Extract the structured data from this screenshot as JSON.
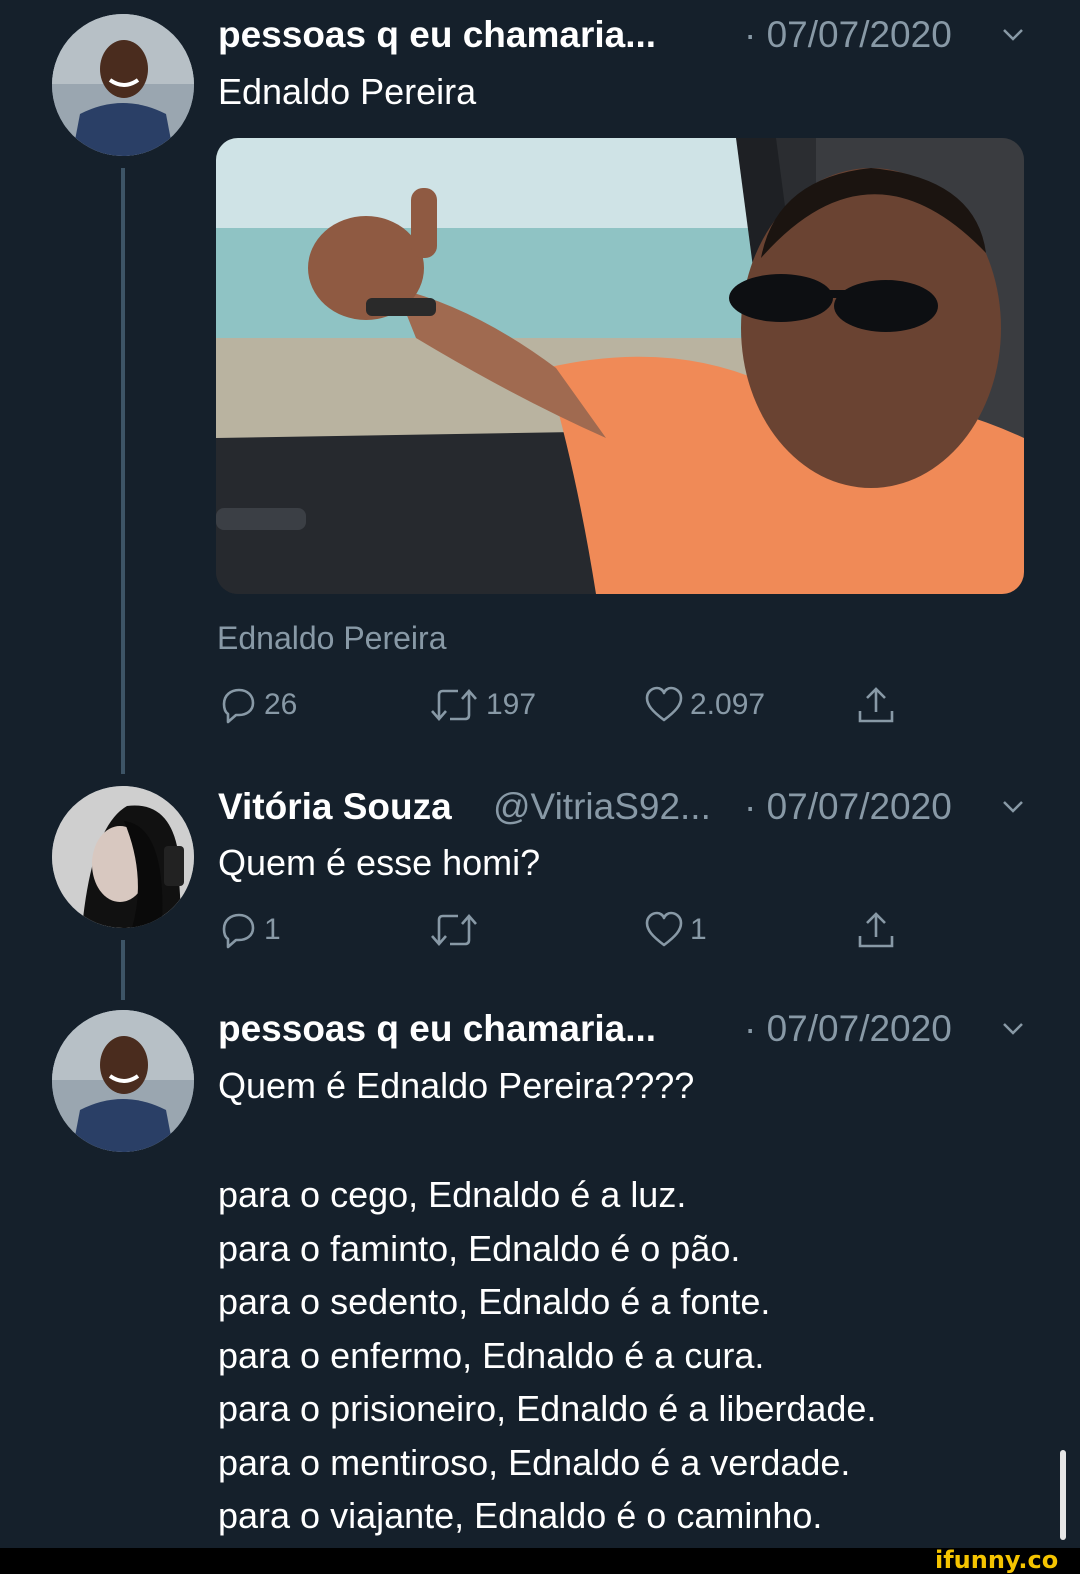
{
  "tweets": [
    {
      "author": "pessoas q eu chamaria...",
      "date": "· 07/07/2020",
      "text": "Ednaldo Pereira",
      "caption": "Ednaldo Pereira",
      "stats": {
        "replies": "26",
        "retweets": "197",
        "likes": "2.097"
      }
    },
    {
      "author": "Vitória Souza",
      "handle": "@VitriaS92...",
      "date": "· 07/07/2020",
      "text": "Quem é esse homi?",
      "stats": {
        "replies": "1",
        "retweets": "",
        "likes": "1"
      }
    },
    {
      "author": "pessoas q eu chamaria...",
      "date": "· 07/07/2020",
      "text": "Quem é Ednaldo Pereira????",
      "poem": [
        "para o cego, Ednaldo é a luz.",
        "para o faminto, Ednaldo é o pão.",
        "para o sedento, Ednaldo é a fonte.",
        "para o enfermo, Ednaldo é a cura.",
        "para o prisioneiro, Ednaldo é a liberdade.",
        "para o mentiroso, Ednaldo é a verdade.",
        "para o viajante, Ednaldo é o caminho."
      ]
    }
  ],
  "watermark": "ifunny.co",
  "icons": [
    "reply-icon",
    "retweet-icon",
    "like-icon",
    "share-icon",
    "chevron-down-icon"
  ],
  "colors": {
    "background": "#15202b",
    "secondary_text": "#8899a6",
    "thread_line": "#3d5466",
    "watermark": "#f5c400"
  }
}
